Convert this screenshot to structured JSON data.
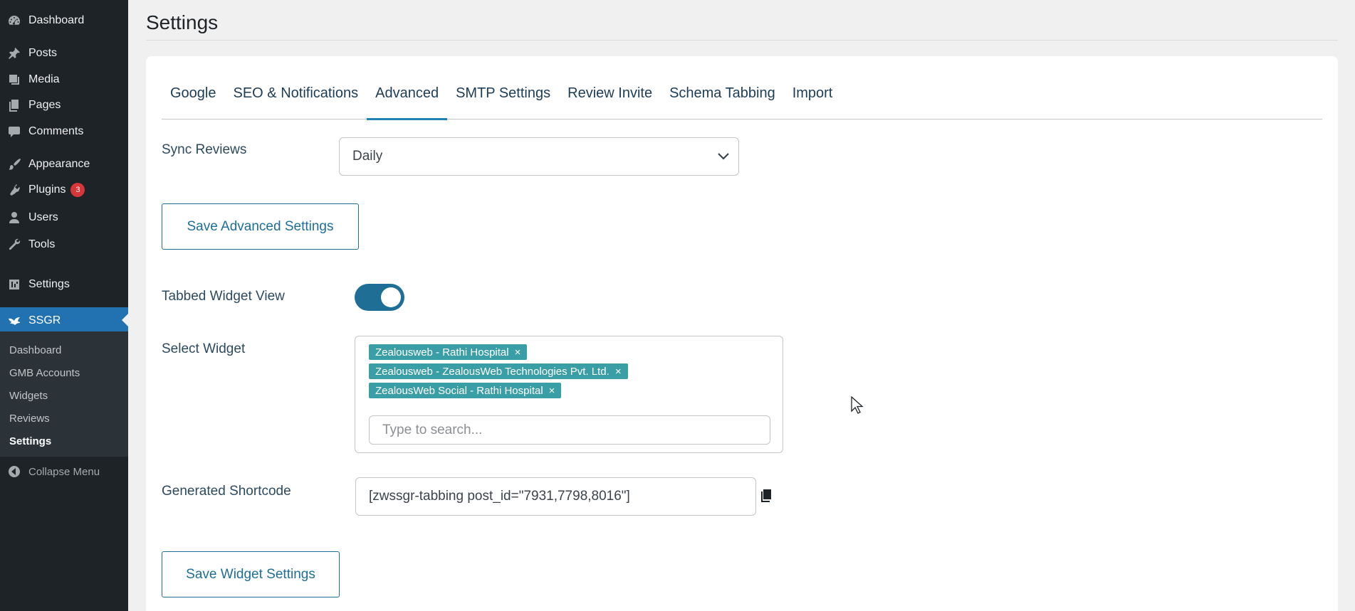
{
  "sidebar": {
    "items": [
      {
        "label": "Dashboard",
        "icon": "dashboard-icon"
      },
      {
        "label": "Posts",
        "icon": "pushpin-icon"
      },
      {
        "label": "Media",
        "icon": "media-icon"
      },
      {
        "label": "Pages",
        "icon": "pages-icon"
      },
      {
        "label": "Comments",
        "icon": "comment-icon"
      },
      {
        "label": "Appearance",
        "icon": "paintbrush-icon"
      },
      {
        "label": "Plugins",
        "icon": "plugin-icon",
        "badge": "3"
      },
      {
        "label": "Users",
        "icon": "user-icon"
      },
      {
        "label": "Tools",
        "icon": "wrench-icon"
      },
      {
        "label": "Settings",
        "icon": "settings-icon"
      },
      {
        "label": "SSGR",
        "icon": "ssgr-icon"
      }
    ],
    "submenu": [
      "Dashboard",
      "GMB Accounts",
      "Widgets",
      "Reviews",
      "Settings"
    ],
    "collapse_label": "Collapse Menu"
  },
  "page": {
    "title": "Settings"
  },
  "tabs": [
    "Google",
    "SEO & Notifications",
    "Advanced",
    "SMTP Settings",
    "Review Invite",
    "Schema Tabbing",
    "Import"
  ],
  "active_tab": "Advanced",
  "sync_reviews": {
    "label": "Sync Reviews",
    "value": "Daily"
  },
  "save_advanced_label": "Save Advanced Settings",
  "tabbed_widget": {
    "label": "Tabbed Widget View",
    "enabled": true
  },
  "select_widget": {
    "label": "Select Widget",
    "chips": [
      "Zealousweb - Rathi Hospital",
      "Zealousweb - ZealousWeb Technologies Pvt. Ltd.",
      "ZealousWeb Social - Rathi Hospital"
    ],
    "remove_glyph": "×",
    "search_placeholder": "Type to search..."
  },
  "shortcode": {
    "label": "Generated Shortcode",
    "value": "[zwssgr-tabbing post_id=\"7931,7798,8016\"]"
  },
  "save_widget_label": "Save Widget Settings",
  "colors": {
    "sidebar_bg": "#1d2327",
    "active_menu": "#2271b1",
    "accent": "#1e6e96",
    "chip": "#3a9ea6",
    "badge": "#d63638"
  }
}
